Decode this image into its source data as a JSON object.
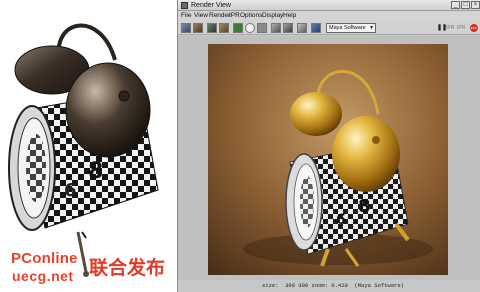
{
  "watermark": {
    "line1": "PConline",
    "line2": "uecg.net",
    "cjk": "联合发布"
  },
  "window": {
    "title": "Render View",
    "menu": [
      "File",
      "View",
      "Render",
      "IPR",
      "Options",
      "Display",
      "Help"
    ],
    "renderer": "Maya Software",
    "ipr_labels": [
      "IPR",
      "IPR"
    ],
    "status": "size:  300 300 zoom: 0.420  (Maya Software)"
  },
  "colors": {
    "chrome": "#c8c8c8",
    "gold": "#c8951c",
    "backdrop": "#7a5530",
    "stop": "#d6321f",
    "watermark": "#e8412e"
  }
}
